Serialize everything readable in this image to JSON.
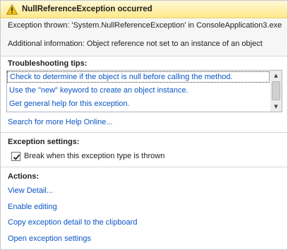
{
  "header": {
    "icon": "warning-icon",
    "title": "NullReferenceException occurred",
    "background": "#ffe98a"
  },
  "exception": {
    "thrown": "Exception thrown: 'System.NullReferenceException' in ConsoleApplication3.exe",
    "additional_info": "Additional information: Object reference not set to an instance of an object"
  },
  "troubleshooting": {
    "title": "Troubleshooting tips:",
    "tips": [
      "Check to determine if the object is null before calling the method.",
      "Use the \"new\" keyword to create an object instance.",
      "Get general help for this exception."
    ],
    "search_link": "Search for more Help Online..."
  },
  "settings": {
    "title": "Exception settings:",
    "break_label": "Break when this exception type is thrown",
    "break_checked": true
  },
  "actions": {
    "title": "Actions:",
    "items": [
      "View Detail...",
      "Enable editing",
      "Copy exception detail to the clipboard",
      "Open exception settings"
    ]
  },
  "colors": {
    "link": "#0b55c4",
    "header_top": "#fff9d8",
    "header_bottom": "#ffe98a"
  }
}
